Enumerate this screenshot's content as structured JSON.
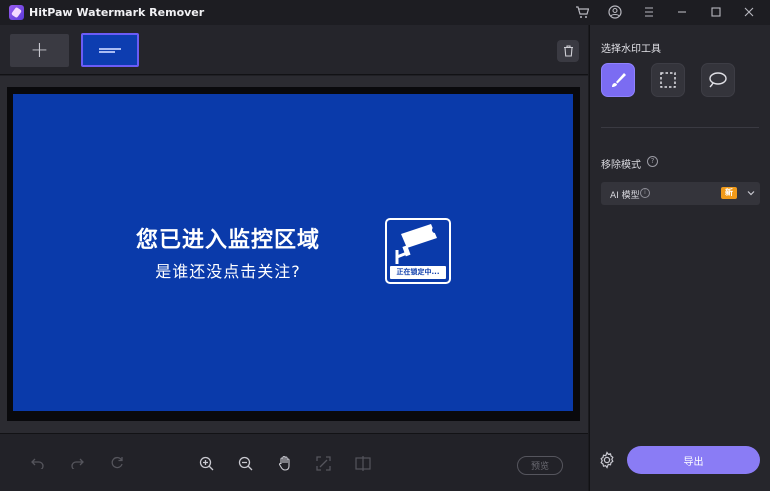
{
  "window": {
    "title": "HitPaw Watermark Remover"
  },
  "thumbnails": {
    "add_label": "+"
  },
  "canvas": {
    "headline": "您已进入监控区域",
    "subline": "是谁还没点击关注?",
    "badge_caption": "正在锁定中..."
  },
  "bottom_toolbar": {
    "preview_label": "预览"
  },
  "right_panel": {
    "tools_title": "选择水印工具",
    "mode_title": "移除模式",
    "mode_help": "?",
    "mode_select": {
      "value": "AI 模型",
      "info": "i",
      "badge": "新"
    },
    "export_label": "导出"
  },
  "colors": {
    "accent": "#8a7cf5",
    "image_blue": "#0a3aaa",
    "new_badge": "#f09a1a"
  },
  "icons": [
    "cart-icon",
    "user-icon",
    "menu-icon",
    "minimize-icon",
    "maximize-icon",
    "close-icon",
    "trash-icon",
    "brush-icon",
    "rectangle-select-icon",
    "lasso-icon",
    "undo-icon",
    "redo-icon",
    "reset-icon",
    "zoom-in-icon",
    "zoom-out-icon",
    "hand-icon",
    "fit-screen-icon",
    "compare-icon",
    "settings-icon"
  ]
}
